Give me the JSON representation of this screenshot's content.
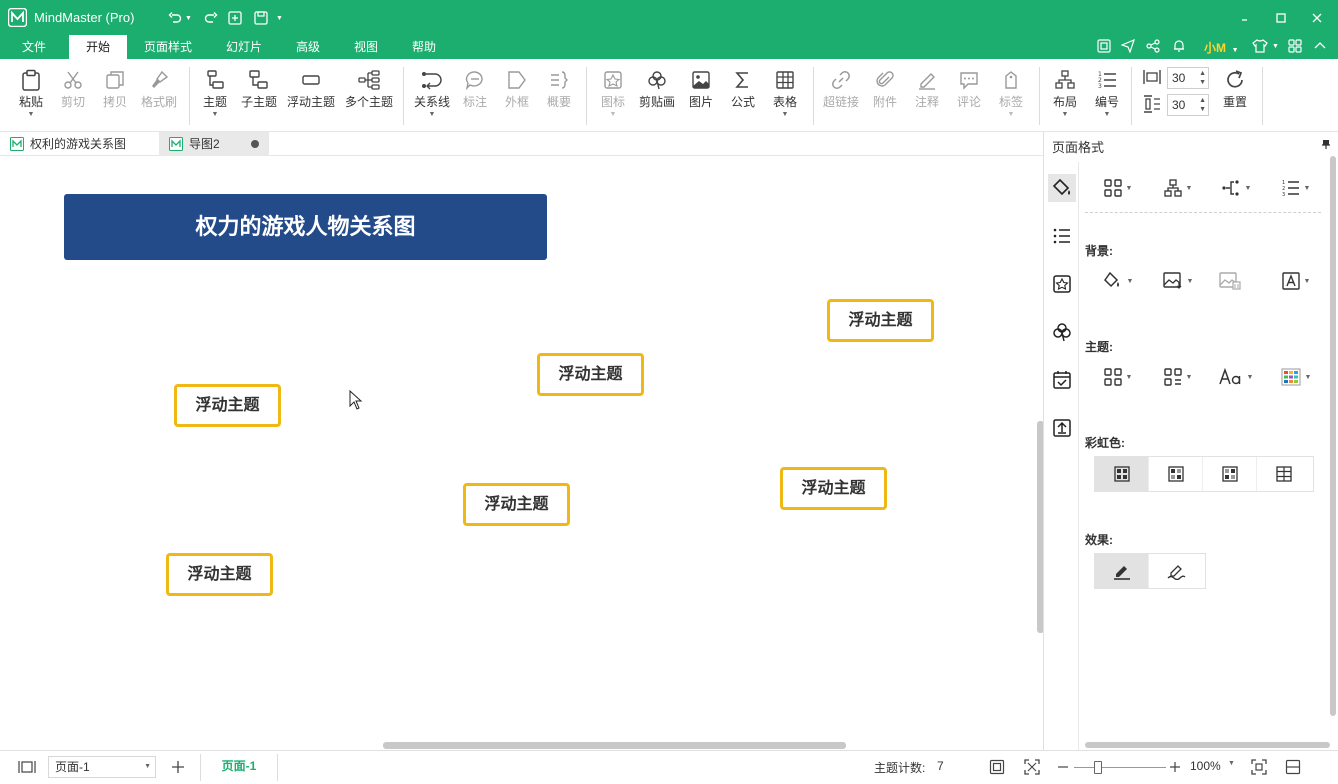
{
  "window": {
    "title": "MindMaster (Pro)"
  },
  "menu": {
    "items": [
      "文件",
      "开始",
      "页面样式",
      "幻灯片",
      "高级",
      "视图",
      "帮助"
    ],
    "active": "开始",
    "user": "小M"
  },
  "ribbon": {
    "paste": "粘贴",
    "cut": "剪切",
    "copy": "拷贝",
    "format_painter": "格式刷",
    "topic": "主题",
    "subtopic": "子主题",
    "floating_topic": "浮动主题",
    "multi_topic": "多个主题",
    "relationship": "关系线",
    "callout": "标注",
    "boundary": "外框",
    "summary": "概要",
    "icon": "图标",
    "clipart": "剪贴画",
    "picture": "图片",
    "formula": "公式",
    "table": "表格",
    "hyperlink": "超链接",
    "attachment": "附件",
    "note": "注释",
    "comment": "评论",
    "tag": "标签",
    "layout": "布局",
    "numbering": "编号",
    "spacing_h": "30",
    "spacing_v": "30",
    "reset": "重置"
  },
  "doc_tabs": [
    {
      "name": "权利的游戏关系图"
    },
    {
      "name": "导图2"
    }
  ],
  "canvas": {
    "main_title": "权力的游戏人物关系图",
    "floating_topics": [
      "浮动主题",
      "浮动主题",
      "浮动主题",
      "浮动主题",
      "浮动主题",
      "浮动主题"
    ]
  },
  "right_panel": {
    "title": "页面格式",
    "background_label": "背景:",
    "theme_label": "主题:",
    "rainbow_label": "彩虹色:",
    "effect_label": "效果:"
  },
  "statusbar": {
    "page_select": "页面-1",
    "active_page_tab": "页面-1",
    "topic_count_label": "主题计数:",
    "topic_count": "7",
    "zoom": "100%"
  },
  "colors": {
    "brand_green": "#1cae6f",
    "title_box_bg": "#234a89",
    "floating_border": "#f0b814"
  }
}
